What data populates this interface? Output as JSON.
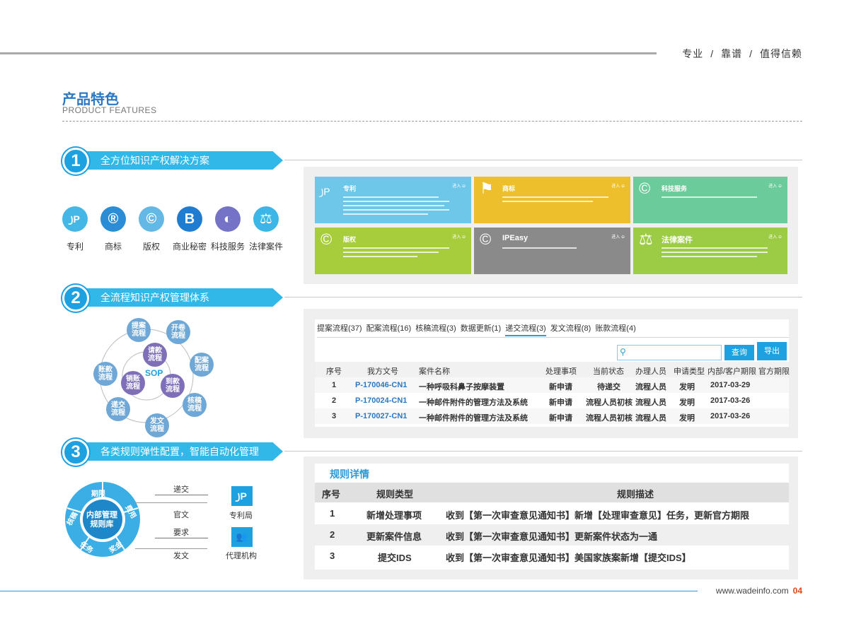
{
  "header": {
    "slogan": [
      "专业",
      "靠谱",
      "值得信赖"
    ],
    "slogan_sep": "/"
  },
  "title": {
    "cn": "产品特色",
    "en": "PRODUCT FEATURES"
  },
  "colors": {
    "accent": "#1da1e1",
    "bar": "#31b7e8",
    "page_number": "#e0461c"
  },
  "sections": [
    {
      "number": "1",
      "title": "全方位知识产权解决方案"
    },
    {
      "number": "2",
      "title": "全流程知识产权管理体系"
    },
    {
      "number": "3",
      "title": "各类规则弹性配置，智能自动化管理"
    }
  ],
  "ip_types": [
    {
      "label": "专利",
      "icon": "patent-icon",
      "glyph": "꠸P",
      "color": "#45b7e6"
    },
    {
      "label": "商标",
      "icon": "registered-icon",
      "glyph": "®",
      "color": "#2a8dd6"
    },
    {
      "label": "版权",
      "icon": "copyright-icon",
      "glyph": "©",
      "color": "#63b8e5"
    },
    {
      "label": "商业秘密",
      "icon": "secret-icon",
      "glyph": "B",
      "color": "#1f7dd1"
    },
    {
      "label": "科技服务",
      "icon": "planet-icon",
      "glyph": "◐",
      "color": "#7473c8"
    },
    {
      "label": "法律案件",
      "icon": "scale-icon",
      "glyph": "⚖",
      "color": "#3bb6e6"
    }
  ],
  "tiles": [
    {
      "title": "专利",
      "enter": "进入 ⊖",
      "color": "#6ec6e8",
      "glyph": "꠸P",
      "icon": "patent-icon"
    },
    {
      "title": "商标",
      "enter": "进入 ⊖",
      "color": "#eebf2c",
      "glyph": "⚑",
      "icon": "flag-icon"
    },
    {
      "title": "科技服务",
      "enter": "进入 ⊖",
      "color": "#6ccb9b",
      "glyph": "©",
      "icon": "copyright-icon"
    },
    {
      "title": "版权",
      "enter": "进入 ⊖",
      "color": "#a8cd3c",
      "glyph": "©",
      "icon": "copyright-icon"
    },
    {
      "title": "IPEasy",
      "enter": "进入 ⊖",
      "color": "#8a8a8a",
      "glyph": "©",
      "icon": "copyright-icon"
    },
    {
      "title": "法律案件",
      "enter": "进入 ⊖",
      "color": "#9ccc45",
      "glyph": "⚖",
      "icon": "scale-icon"
    }
  ],
  "flow": {
    "nodes": [
      "提案\n流程",
      "开卷\n流程",
      "配案\n流程",
      "核稿\n流程",
      "发文\n流程",
      "递交\n流程",
      "账款\n流程",
      "请款\n流程",
      "到款\n流程",
      "销账\n流程"
    ],
    "center": "SOP"
  },
  "workflow": {
    "tabs": [
      "提案流程(37)",
      "配案流程(16)",
      "核稿流程(3)",
      "数据更新(1)",
      "递交流程(3)",
      "发文流程(8)",
      "账款流程(4)"
    ],
    "active_tab": 4,
    "search_placeholder": "",
    "search_btn": "查询",
    "export_btn": "导出",
    "columns": [
      "序号",
      "我方文号",
      "案件名称",
      "处理事项",
      "当前状态",
      "办理人员",
      "申请类型",
      "内部/客户期限",
      "官方期限"
    ],
    "rows": [
      [
        "1",
        "P-170046-CN1",
        "一种呼吸科鼻子按摩装置",
        "新申请",
        "待递交",
        "流程人员",
        "发明",
        "2017-03-29",
        ""
      ],
      [
        "2",
        "P-170024-CN1",
        "一种邮件附件的管理方法及系统",
        "新申请",
        "流程人员初核",
        "流程人员",
        "发明",
        "2017-03-26",
        ""
      ],
      [
        "3",
        "P-170027-CN1",
        "一种邮件附件的管理方法及系统",
        "新申请",
        "流程人员初核",
        "流程人员",
        "发明",
        "2017-03-26",
        ""
      ]
    ]
  },
  "ring": {
    "center": "内部管理\n规则库",
    "segments": [
      "期限",
      "费用",
      "奖金",
      "任务",
      "核稿"
    ]
  },
  "exchange": {
    "labels": [
      "递交",
      "官文",
      "要求",
      "发文"
    ],
    "targets": [
      {
        "label": "专利局",
        "glyph": "꠸P",
        "icon": "patent-office-icon"
      },
      {
        "label": "代理机构",
        "glyph": "👥",
        "icon": "agency-icon"
      }
    ]
  },
  "rules": {
    "title": "规则详情",
    "columns": [
      "序号",
      "规则类型",
      "规则描述"
    ],
    "rows": [
      [
        "1",
        "新增处理事项",
        "收到【第一次审查意见通知书】新增【处理审查意见】任务，更新官方期限"
      ],
      [
        "2",
        "更新案件信息",
        "收到【第一次审查意见通知书】更新案件状态为一通"
      ],
      [
        "3",
        "提交IDS",
        "收到【第一次审查意见通知书】美国家族案新增【提交IDS】"
      ]
    ]
  },
  "footer": {
    "site": "www.wadeinfo.com",
    "page": "04"
  }
}
